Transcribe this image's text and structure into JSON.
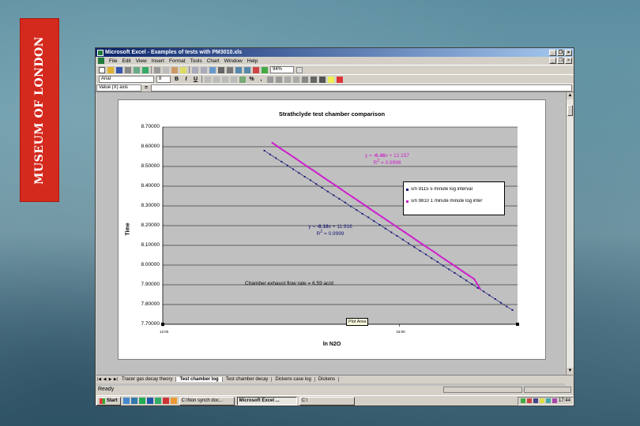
{
  "banner": {
    "text": "MUSEUM OF LONDON"
  },
  "window": {
    "title": "Microsoft Excel - Examples of tests with PM3010.xls",
    "menus": [
      "File",
      "Edit",
      "View",
      "Insert",
      "Format",
      "Tools",
      "Chart",
      "Window",
      "Help"
    ],
    "zoom": "94%",
    "font_name": "Arial",
    "font_size": "8",
    "name_box": "Value (X) axis",
    "formula_eq": "="
  },
  "chart_data": {
    "type": "scatter",
    "title": "Strathclyde test chamber comparison",
    "xlabel": "ln N2O",
    "ylabel": "Time",
    "ylim": [
      7.7,
      8.7
    ],
    "y_ticks": [
      "8.70000",
      "8.60000",
      "8.50000",
      "8.40000",
      "8.30000",
      "8.20000",
      "8.10000",
      "8.00000",
      "7.90000",
      "7.80000",
      "7.70000"
    ],
    "x_ticks": [
      "12:00",
      "15:00"
    ],
    "x_tick_values": [
      0.5,
      0.625
    ],
    "xlim": [
      0.5,
      0.6875
    ],
    "series": [
      {
        "name": "s/n 9115 5 minute log interval",
        "color": "#1a1a7a",
        "x": [
          0.5537,
          0.5567,
          0.5598,
          0.5628,
          0.5659,
          0.5689,
          0.572,
          0.575,
          0.5781,
          0.5811,
          0.5842,
          0.5872,
          0.5903,
          0.5933,
          0.5964,
          0.5994,
          0.6025,
          0.6055,
          0.6086,
          0.6116,
          0.6147,
          0.6177,
          0.6208,
          0.6238,
          0.6269,
          0.6299,
          0.633,
          0.636,
          0.6391,
          0.6421,
          0.6452,
          0.6482,
          0.6513,
          0.6543,
          0.6574,
          0.6604,
          0.6635,
          0.6665,
          0.6696,
          0.6726,
          0.6757,
          0.6787,
          0.6818,
          0.6848
        ],
        "y": [
          8.58,
          8.561,
          8.542,
          8.524,
          8.505,
          8.486,
          8.467,
          8.448,
          8.43,
          8.411,
          8.392,
          8.373,
          8.354,
          8.336,
          8.317,
          8.298,
          8.279,
          8.26,
          8.242,
          8.223,
          8.204,
          8.185,
          8.166,
          8.148,
          8.129,
          8.11,
          8.091,
          8.072,
          8.054,
          8.035,
          8.016,
          7.997,
          7.978,
          7.96,
          7.941,
          7.922,
          7.903,
          7.884,
          7.866,
          7.847,
          7.828,
          7.809,
          7.79,
          7.772
        ],
        "trend": {
          "equation_prefix": "y = ",
          "slope": "-6.16",
          "equation_suffix": "x + 11.916",
          "r2_label": "R",
          "r2_value": " = 0.9999"
        }
      },
      {
        "name": "s/n 9810 1 minute minute log inter",
        "color": "#cc22cc",
        "x": [
          0.5579,
          0.5609,
          0.564,
          0.567,
          0.5701,
          0.5731,
          0.5762,
          0.5792,
          0.5823,
          0.5853,
          0.5884,
          0.5914,
          0.5945,
          0.5975,
          0.6006,
          0.6036,
          0.6067,
          0.6097,
          0.6128,
          0.6158,
          0.6189,
          0.6219,
          0.625,
          0.628,
          0.6311,
          0.6341,
          0.6372,
          0.6402,
          0.6433,
          0.6463,
          0.6494,
          0.6524,
          0.6555,
          0.6585,
          0.6616,
          0.6646,
          0.6677
        ],
        "y": [
          8.62,
          8.6,
          8.58,
          8.561,
          8.541,
          8.521,
          8.501,
          8.482,
          8.462,
          8.442,
          8.422,
          8.403,
          8.383,
          8.363,
          8.343,
          8.324,
          8.304,
          8.284,
          8.264,
          8.245,
          8.225,
          8.205,
          8.185,
          8.166,
          8.146,
          8.126,
          8.106,
          8.087,
          8.067,
          8.047,
          8.027,
          8.008,
          7.988,
          7.968,
          7.948,
          7.929,
          7.88
        ],
        "trend": {
          "equation_prefix": "y = ",
          "slope": "-6.46",
          "equation_suffix": "x + 12.157",
          "r2_label": "R",
          "r2_value": " = 0.9996"
        }
      }
    ],
    "annotation": "Chamber exhaust flow rate  = 6.59 ac/d",
    "tooltip": "Plot Area",
    "grid": true,
    "legend_position": "right"
  },
  "sheet_tabs": [
    "Tracer gas decay theory",
    "Test chamber log",
    "Test chamber decay",
    "Dickens case log",
    "Dickens"
  ],
  "active_tab": "Test chamber log",
  "status": "Ready",
  "taskbar": {
    "start": "Start",
    "tasks": [
      "C:\\Non synch doc...",
      "Microsoft Excel ...",
      "C:\\"
    ],
    "clock": "17:44"
  }
}
